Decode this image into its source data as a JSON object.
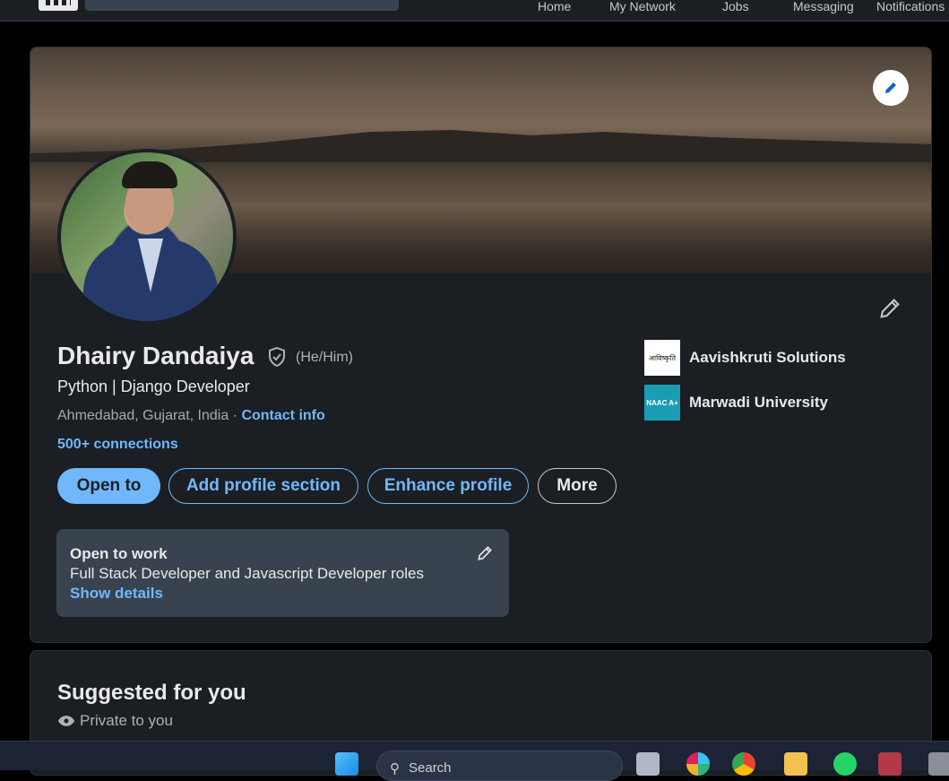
{
  "topnav": {
    "items": [
      "Home",
      "My Network",
      "Jobs",
      "Messaging",
      "Notifications"
    ]
  },
  "profile": {
    "name": "Dhairy Dandaiya",
    "pronouns": "(He/Him)",
    "headline": "Python | Django Developer",
    "location": "Ahmedabad, Gujarat, India · ",
    "contact_info": "Contact info",
    "connections": "500+ connections",
    "buttons": {
      "open_to": "Open to",
      "add_section": "Add profile section",
      "enhance": "Enhance profile",
      "more": "More"
    },
    "open_to_work": {
      "title": "Open to work",
      "roles": "Full Stack Developer and Javascript Developer roles",
      "link": "Show details"
    },
    "orgs": [
      {
        "name": "Aavishkruti Solutions",
        "logo_text": "आविष्कृति"
      },
      {
        "name": "Marwadi University",
        "logo_text": "NAAC A+"
      }
    ]
  },
  "suggested": {
    "title": "Suggested for you",
    "subtitle": "Private to you"
  },
  "taskbar": {
    "search_placeholder": "Search"
  },
  "colors": {
    "accent": "#71b7fb",
    "card_bg": "#1b1f23",
    "otw_bg": "#38434f"
  }
}
